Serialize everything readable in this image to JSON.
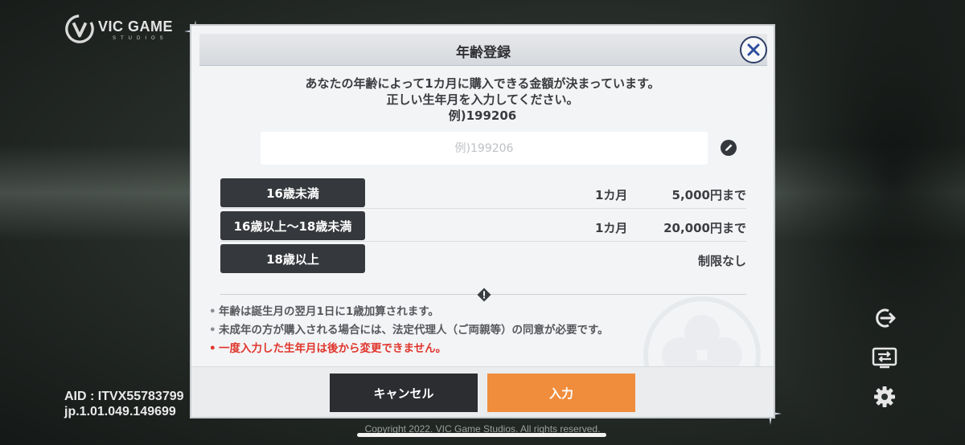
{
  "brand": {
    "logo_title": "VIC GAME",
    "logo_sub": "STUDIOS"
  },
  "aid": {
    "line1": "AID : ITVX55783799",
    "line2": "jp.1.01.049.149699"
  },
  "copyright": "Copyright 2022. VIC Game Studios. All rights reserved.",
  "dialog": {
    "title": "年齢登録",
    "desc": [
      "あなたの年齢によって1カ月に購入できる金額が決まっています。",
      "正しい生年月を入力してください。",
      "例)199206"
    ],
    "input": {
      "placeholder": "例)199206",
      "value": ""
    },
    "tiers": [
      {
        "label": "16歳未満",
        "period": "1カ月",
        "amount": "5,000円まで"
      },
      {
        "label": "16歳以上〜18歳未満",
        "period": "1カ月",
        "amount": "20,000円まで"
      },
      {
        "label": "18歳以上",
        "period": "",
        "amount": "制限なし"
      }
    ],
    "notes": [
      "年齢は誕生月の翌月1日に1歳加算されます。",
      "未成年の方が購入される場合には、法定代理人（ご両親等）の同意が必要です。"
    ],
    "warning": "一度入力した生年月は後から変更できません。",
    "cancel_label": "キャンセル",
    "ok_label": "入力"
  },
  "colors": {
    "accent": "#f08d3c",
    "dark_button": "#2b2d30",
    "warning": "#e0352b",
    "close_ring": "#2d3e66"
  },
  "icons": [
    "close-icon",
    "pencil-icon",
    "warning-icon",
    "logout-icon",
    "switch-account-icon",
    "gear-icon"
  ]
}
